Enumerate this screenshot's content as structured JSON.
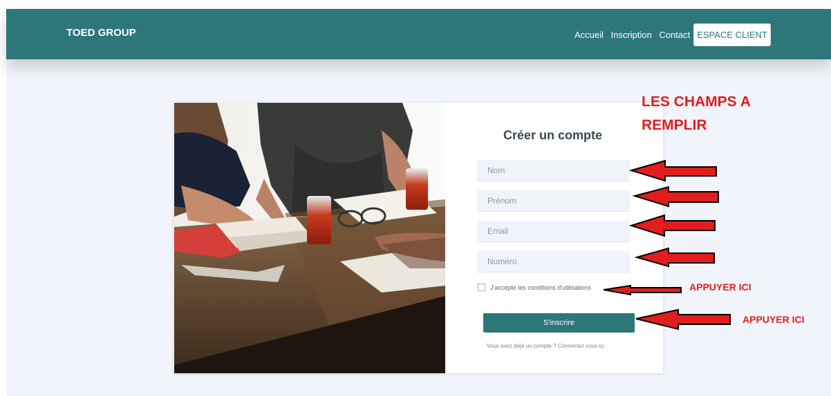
{
  "header": {
    "brand": "TOED GROUP",
    "nav": [
      "Accueil",
      "Inscription",
      "Contact"
    ],
    "cta": "ESPACE CLIENT"
  },
  "form": {
    "title": "Créer un compte",
    "fields": [
      {
        "placeholder": "Nom",
        "value": ""
      },
      {
        "placeholder": "Prénom",
        "value": ""
      },
      {
        "placeholder": "Email",
        "value": ""
      },
      {
        "placeholder": "Numéro",
        "value": ""
      }
    ],
    "terms_label": "J'accepte les conditions d'utilisations",
    "terms_checked": false,
    "submit_label": "S'inscrire",
    "login_link": "Vous avez déjà un compte ? Connectez vous ici"
  },
  "annotations": {
    "title": "LES CHAMPS A REMPLIR",
    "checkbox_hint": "APPUYER ICI",
    "submit_hint": "APPUYER ICI"
  },
  "colors": {
    "brand": "#2d777b",
    "annotation": "#e21d1d",
    "background": "#f1f5fb"
  },
  "icons": [
    "photo-people-at-table",
    "red-arrow-icon"
  ]
}
